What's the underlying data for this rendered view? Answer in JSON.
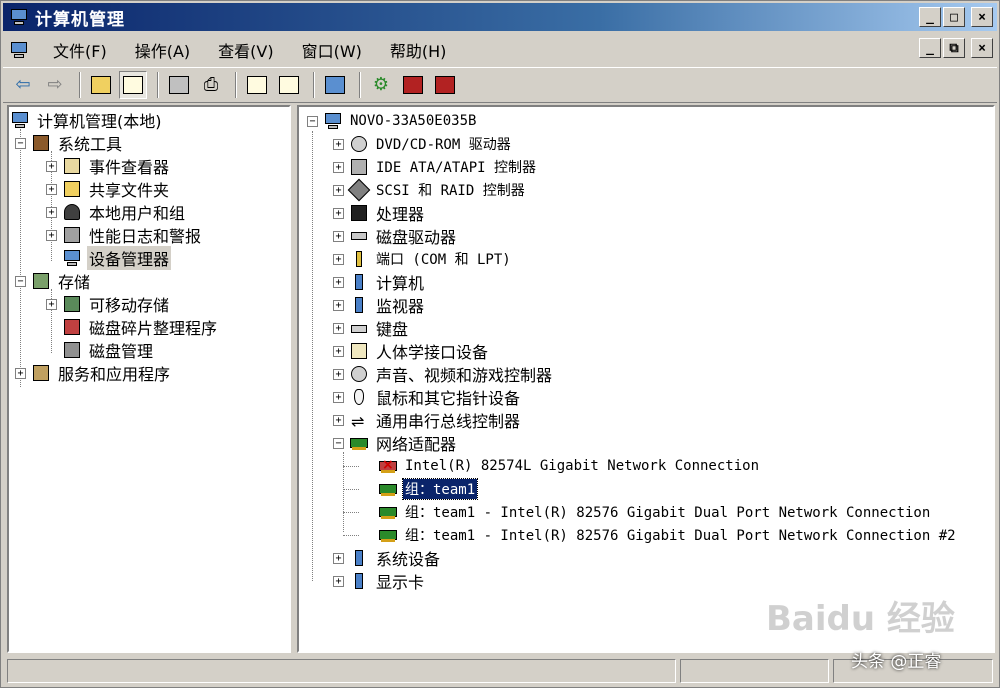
{
  "window": {
    "title": "计算机管理",
    "buttons": {
      "minimize": "_",
      "maximize": "□",
      "close": "×"
    },
    "mdi_buttons": {
      "minimize": "_",
      "restore": "⧉",
      "close": "×"
    }
  },
  "menu": [
    "文件(F)",
    "操作(A)",
    "查看(V)",
    "窗口(W)",
    "帮助(H)"
  ],
  "toolbar_icons": [
    "back-arrow-icon",
    "forward-arrow-icon",
    "up-folder-icon",
    "show-hide-tree-icon",
    "properties-icon",
    "print-icon",
    "help-icon",
    "toggle-pane-icon",
    "scan-hardware-icon",
    "update-driver-icon",
    "disable-device-icon",
    "uninstall-device-icon"
  ],
  "left_tree": {
    "root": "计算机管理(本地)",
    "groups": [
      {
        "label": "系统工具",
        "items": [
          "事件查看器",
          "共享文件夹",
          "本地用户和组",
          "性能日志和警报",
          "设备管理器"
        ]
      },
      {
        "label": "存储",
        "items": [
          "可移动存储",
          "磁盘碎片整理程序",
          "磁盘管理"
        ]
      },
      {
        "label": "服务和应用程序",
        "items": []
      }
    ],
    "selected": "设备管理器"
  },
  "right_tree": {
    "root": "NOVO-33A50E035B",
    "categories": [
      "DVD/CD-ROM 驱动器",
      "IDE ATA/ATAPI 控制器",
      "SCSI 和 RAID 控制器",
      "处理器",
      "磁盘驱动器",
      "端口 (COM 和 LPT)",
      "计算机",
      "监视器",
      "键盘",
      "人体学接口设备",
      "声音、视频和游戏控制器",
      "鼠标和其它指针设备",
      "通用串行总线控制器",
      "网络适配器"
    ],
    "network_adapters": [
      "Intel(R) 82574L Gigabit Network Connection",
      "组：team1",
      "组：team1 - Intel(R) 82576 Gigabit Dual Port Network Connection",
      "组：team1 - Intel(R) 82576 Gigabit Dual Port Network Connection #2"
    ],
    "after": [
      "系统设备",
      "显示卡"
    ],
    "selected": "组：team1"
  },
  "watermarks": {
    "baidu": "Baidu 经验",
    "credit": "头条 @正睿"
  }
}
